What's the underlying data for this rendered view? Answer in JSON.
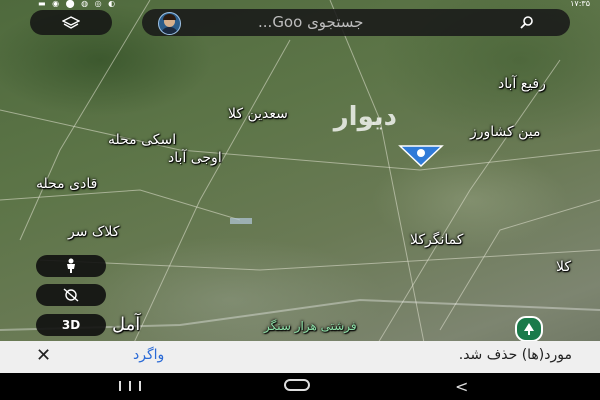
{
  "status_bar": {
    "time": "۱۷:۳۵",
    "icons": [
      "battery-icon",
      "signal-icon",
      "wifi-icon",
      "instagram-icon",
      "whatsapp-icon",
      "camera-icon"
    ]
  },
  "search": {
    "placeholder": "جستجوی Goo..."
  },
  "map": {
    "labels": [
      {
        "id": "rafi-abad",
        "text": "رفیع آباد"
      },
      {
        "id": "sadin-kola",
        "text": "سعدین کلا"
      },
      {
        "id": "askimahalleh",
        "text": "اسکی محله"
      },
      {
        "id": "oji-abad",
        "text": "اوجی آباد"
      },
      {
        "id": "ghadi-mahalleh",
        "text": "قادی محله"
      },
      {
        "id": "zamin-keshavarzi",
        "text": "مین کشاورز"
      },
      {
        "id": "kala-sar",
        "text": "کلاک سر"
      },
      {
        "id": "kamangar-kola",
        "text": "کمانگرکلا"
      },
      {
        "id": "kola-edge",
        "text": "کلا"
      },
      {
        "id": "amol",
        "text": "آمل"
      },
      {
        "id": "hezar-sangar",
        "text": "فرشتی هزار سنگر"
      }
    ],
    "watermark": "دیوار"
  },
  "controls": {
    "btn_3d": "3D"
  },
  "snackbar": {
    "message": "مورد(ها) حذف شد.",
    "undo": "واگرد",
    "close": "✕"
  }
}
